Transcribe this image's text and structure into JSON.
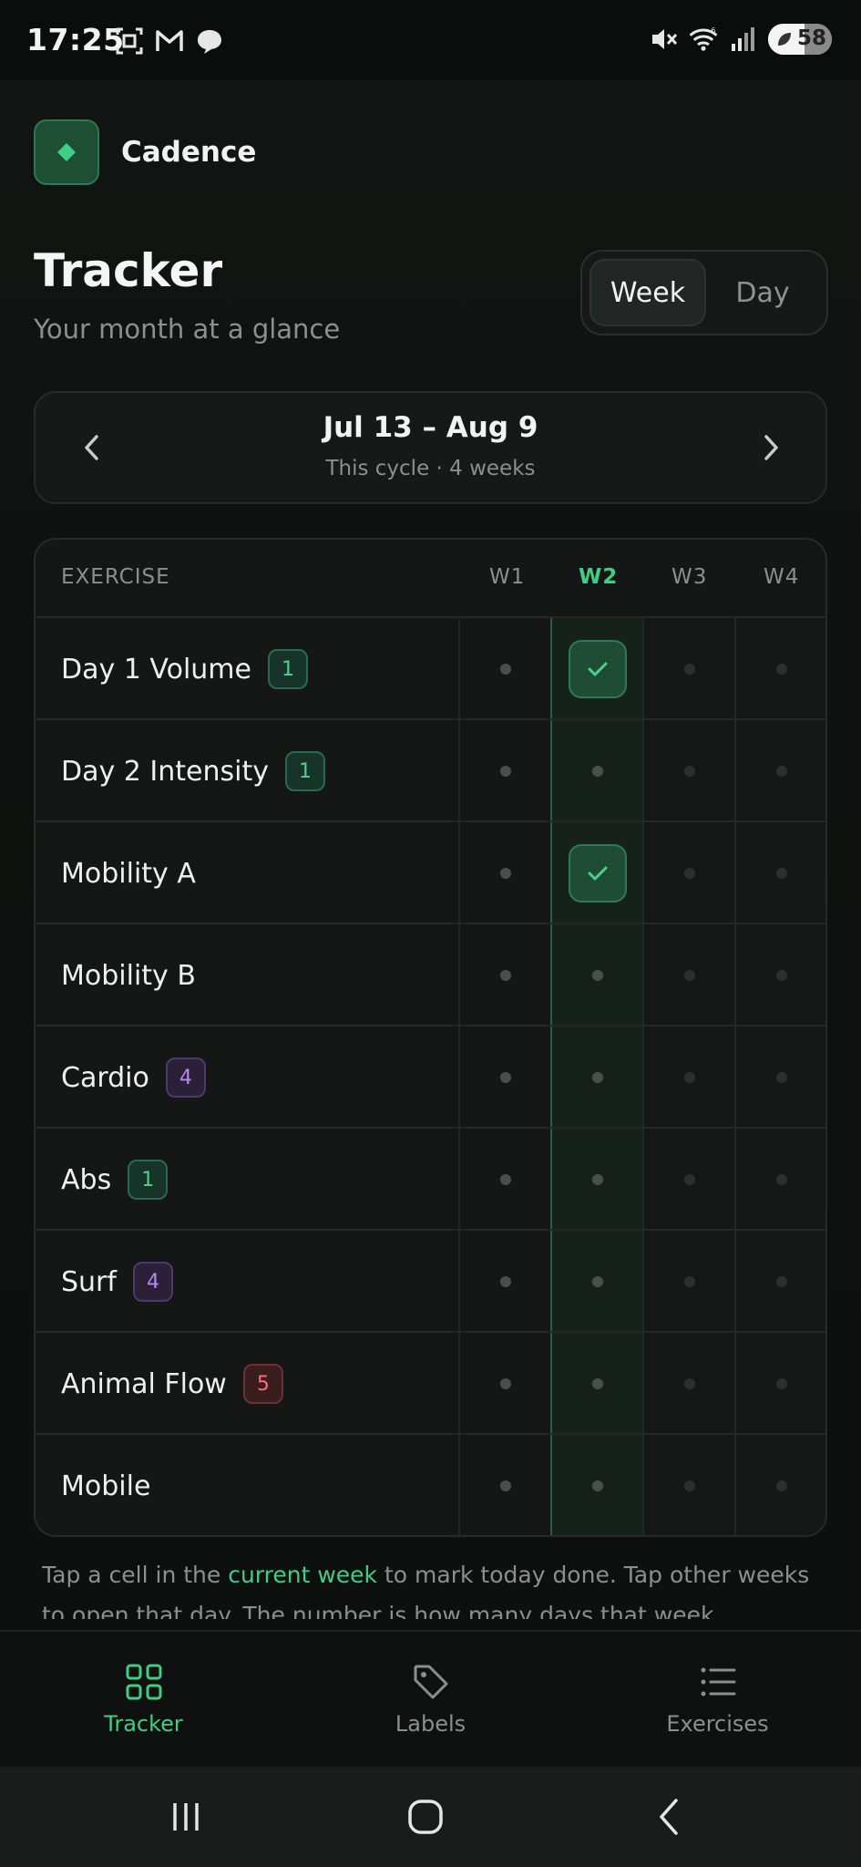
{
  "status_bar": {
    "time": "17:25",
    "left_icons": [
      "screenshot-icon",
      "gmail-icon",
      "chat-icon"
    ],
    "right_icons": [
      "mute-icon",
      "wifi-icon",
      "signal-icon"
    ],
    "wifi_badge": "6",
    "battery_percent": "58"
  },
  "brand": {
    "name": "Cadence"
  },
  "header": {
    "title": "Tracker",
    "subtitle": "Your month at a glance",
    "view_toggle": {
      "options": [
        "Week",
        "Day"
      ],
      "selected": "Week"
    }
  },
  "date_nav": {
    "range": "Jul 13 – Aug 9",
    "subtitle": "This cycle · 4 weeks"
  },
  "table": {
    "header": {
      "exercise": "EXERCISE",
      "weeks": [
        "W1",
        "W2",
        "W3",
        "W4"
      ],
      "current_week_index": 1
    },
    "rows": [
      {
        "name": "Day 1 Volume",
        "badge": "1",
        "badge_color": "green",
        "cells": [
          "dot",
          "check",
          "faint",
          "faint"
        ]
      },
      {
        "name": "Day 2 Intensity",
        "badge": "1",
        "badge_color": "green",
        "cells": [
          "dot",
          "dot",
          "faint",
          "faint"
        ]
      },
      {
        "name": "Mobility A",
        "badge": "",
        "badge_color": "",
        "cells": [
          "dot",
          "check",
          "faint",
          "faint"
        ]
      },
      {
        "name": "Mobility B",
        "badge": "",
        "badge_color": "",
        "cells": [
          "dot",
          "dot",
          "faint",
          "faint"
        ]
      },
      {
        "name": "Cardio",
        "badge": "4",
        "badge_color": "purple",
        "cells": [
          "dot",
          "dot",
          "faint",
          "faint"
        ]
      },
      {
        "name": "Abs",
        "badge": "1",
        "badge_color": "green",
        "cells": [
          "dot",
          "dot",
          "faint",
          "faint"
        ]
      },
      {
        "name": "Surf",
        "badge": "4",
        "badge_color": "purple",
        "cells": [
          "dot",
          "dot",
          "faint",
          "faint"
        ]
      },
      {
        "name": "Animal Flow",
        "badge": "5",
        "badge_color": "red",
        "cells": [
          "dot",
          "dot",
          "faint",
          "faint"
        ]
      },
      {
        "name": "Mobile",
        "badge": "",
        "badge_color": "",
        "cells": [
          "dot",
          "dot",
          "faint",
          "faint"
        ]
      }
    ]
  },
  "hint": {
    "part1": "Tap a cell in the ",
    "highlight": "current week",
    "part2": " to mark today done. Tap other weeks to open that day. The number is how many days that week."
  },
  "bottom_nav": {
    "items": [
      {
        "label": "Tracker",
        "icon": "grid-icon",
        "active": true
      },
      {
        "label": "Labels",
        "icon": "tag-icon",
        "active": false
      },
      {
        "label": "Exercises",
        "icon": "list-icon",
        "active": false
      }
    ]
  },
  "colors": {
    "accent": "#3fcf84",
    "background": "#0d0e0e",
    "card": "#161918",
    "badge_green": "#4fd08c",
    "badge_purple": "#b788ee",
    "badge_red": "#ff6f6f"
  }
}
